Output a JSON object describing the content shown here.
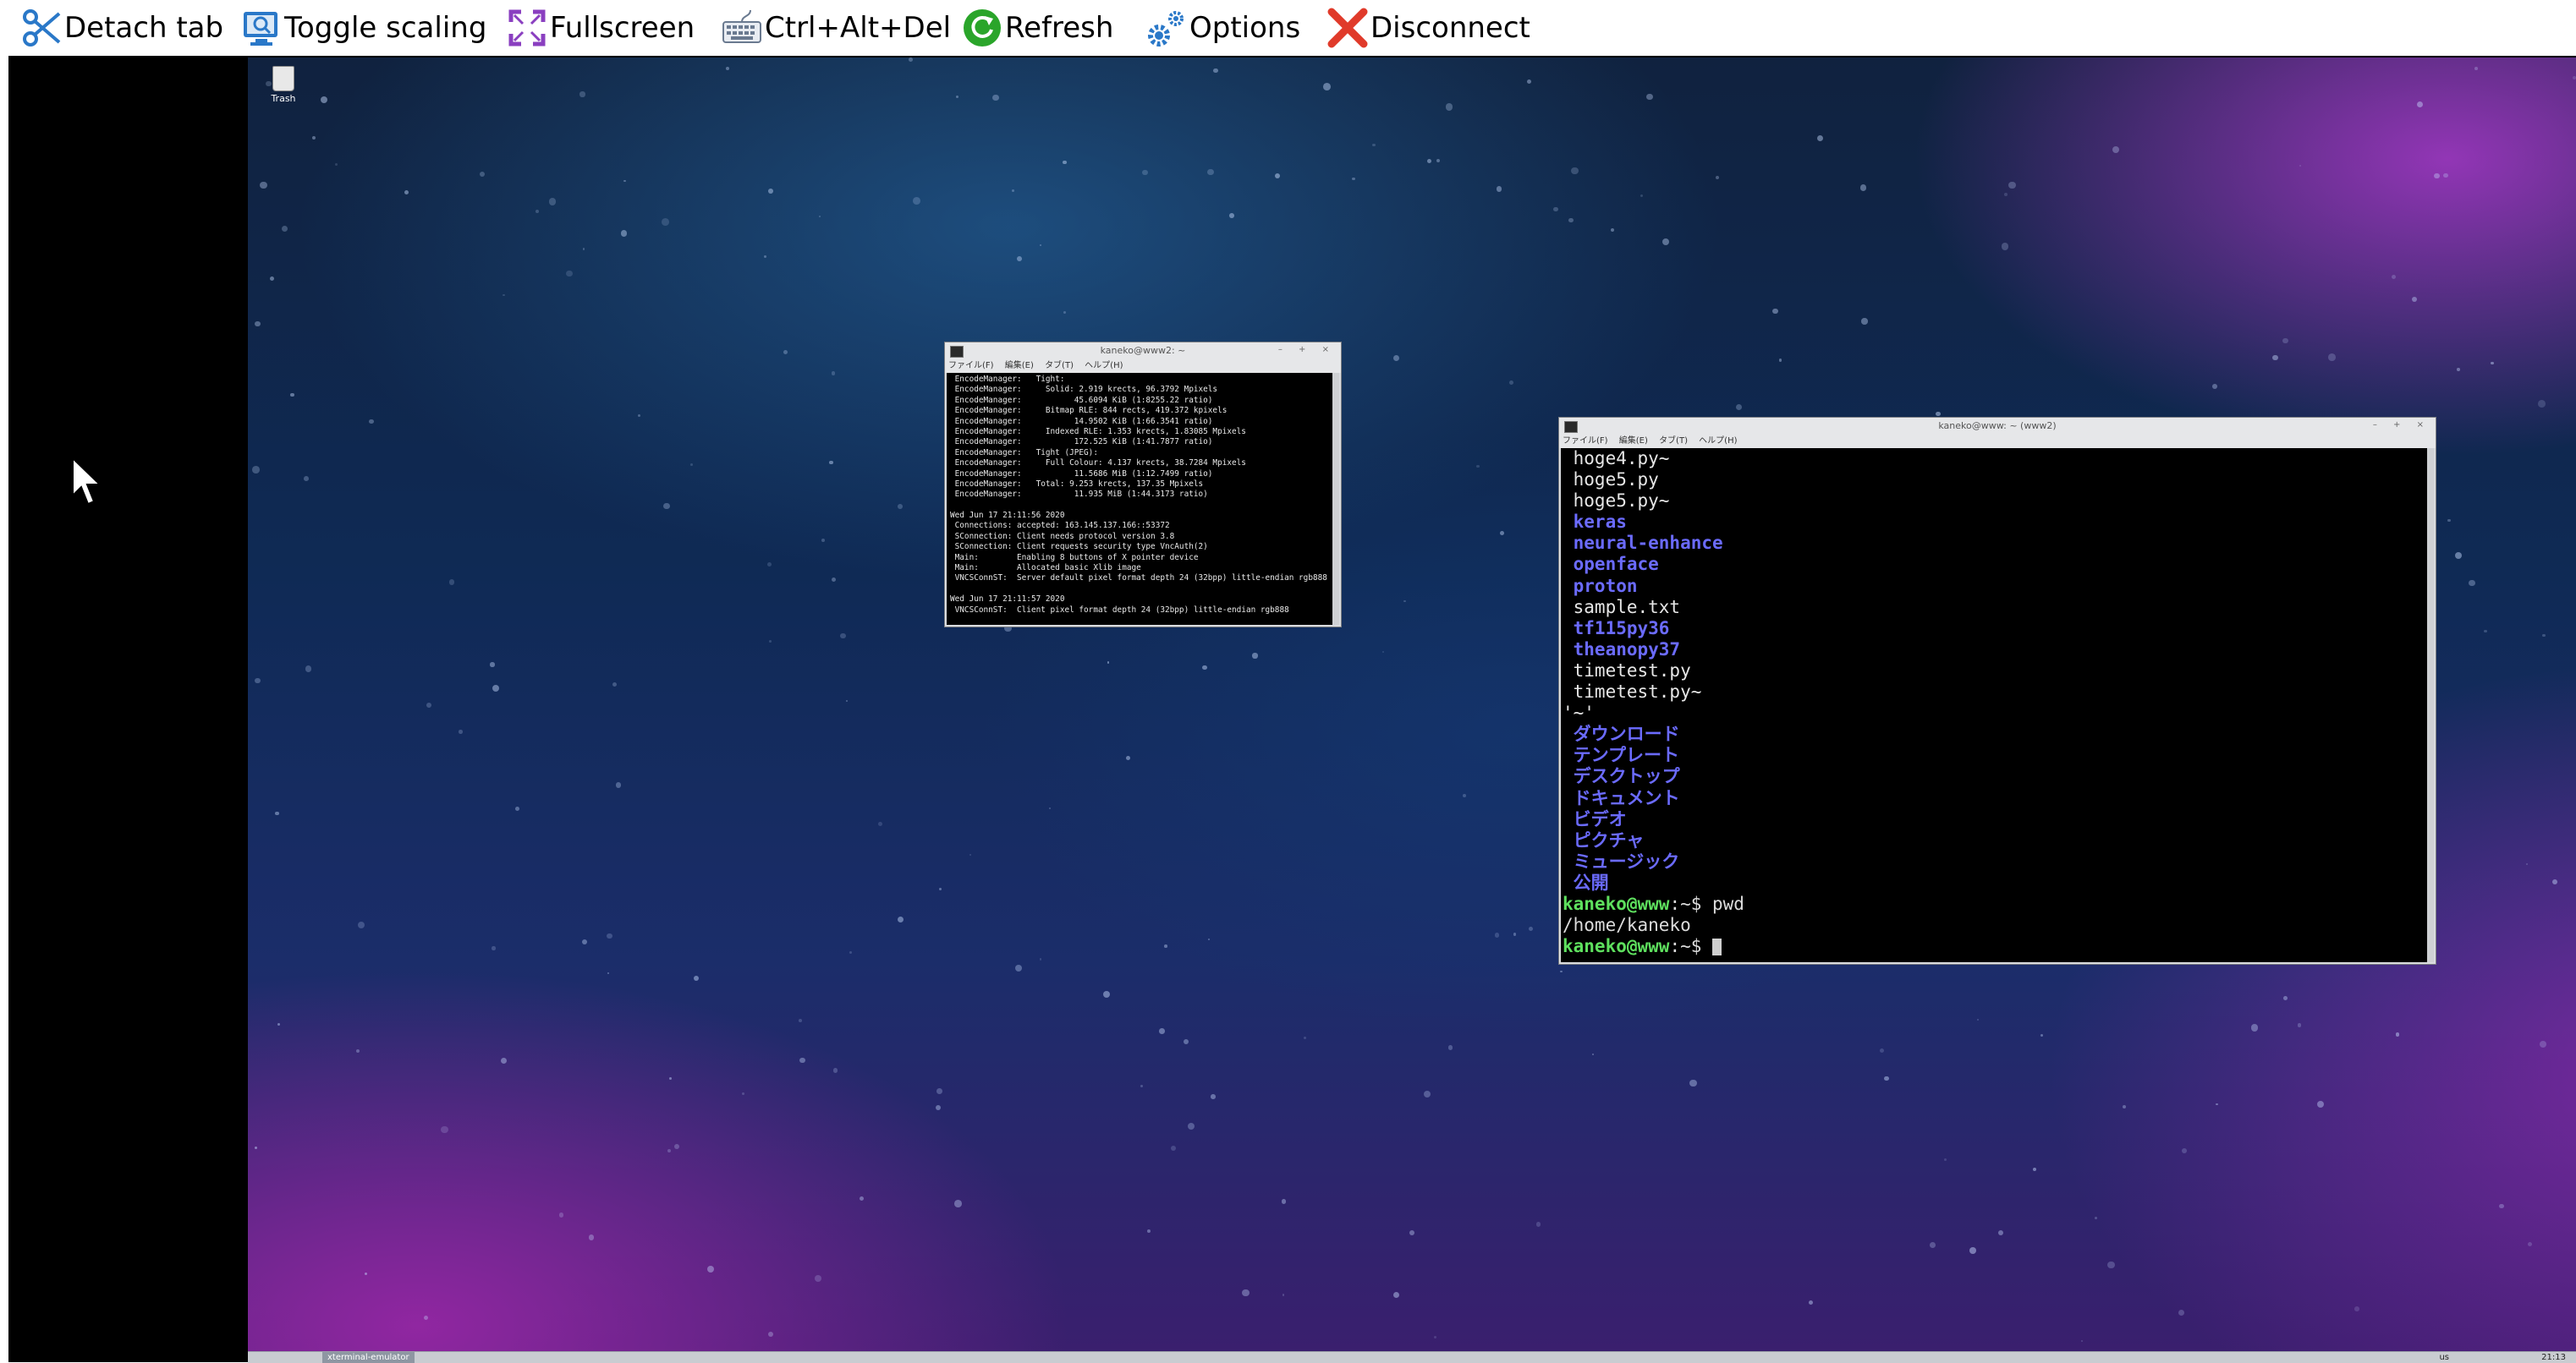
{
  "toolbar": {
    "detach": "Detach tab",
    "scaling": "Toggle scaling",
    "fullscreen": "Fullscreen",
    "cad": "Ctrl+Alt+Del",
    "refresh": "Refresh",
    "options": "Options",
    "disconnect": "Disconnect"
  },
  "desktop": {
    "trash_label": "Trash"
  },
  "taskbar": {
    "task_label": "xterminal-emulator",
    "lang": "us",
    "clock": "21:13"
  },
  "small_terminal": {
    "title": "kaneko@www2: ~",
    "menu": [
      "ファイル(F)",
      "編集(E)",
      "タブ(T)",
      "ヘルプ(H)"
    ],
    "lines": [
      " EncodeManager:   Tight:",
      " EncodeManager:     Solid: 2.919 krects, 96.3792 Mpixels",
      " EncodeManager:           45.6094 KiB (1:8255.22 ratio)",
      " EncodeManager:     Bitmap RLE: 844 rects, 419.372 kpixels",
      " EncodeManager:           14.9502 KiB (1:66.3541 ratio)",
      " EncodeManager:     Indexed RLE: 1.353 krects, 1.83085 Mpixels",
      " EncodeManager:           172.525 KiB (1:41.7877 ratio)",
      " EncodeManager:   Tight (JPEG):",
      " EncodeManager:     Full Colour: 4.137 krects, 38.7284 Mpixels",
      " EncodeManager:           11.5686 MiB (1:12.7499 ratio)",
      " EncodeManager:   Total: 9.253 krects, 137.35 Mpixels",
      " EncodeManager:           11.935 MiB (1:44.3173 ratio)",
      "",
      "Wed Jun 17 21:11:56 2020",
      " Connections: accepted: 163.145.137.166::53372",
      " SConnection: Client needs protocol version 3.8",
      " SConnection: Client requests security type VncAuth(2)",
      " Main:        Enabling 8 buttons of X pointer device",
      " Main:        Allocated basic Xlib image",
      " VNCSConnST:  Server default pixel format depth 24 (32bpp) little-endian rgb888",
      "",
      "Wed Jun 17 21:11:57 2020",
      " VNCSConnST:  Client pixel format depth 24 (32bpp) little-endian rgb888"
    ]
  },
  "large_terminal": {
    "title": "kaneko@www: ~ (www2)",
    "menu": [
      "ファイル(F)",
      "編集(E)",
      "タブ(T)",
      "ヘルプ(H)"
    ],
    "entries": [
      {
        "text": " hoge4.py~",
        "kind": "file"
      },
      {
        "text": " hoge5.py",
        "kind": "file"
      },
      {
        "text": " hoge5.py~",
        "kind": "file"
      },
      {
        "text": " keras",
        "kind": "dir"
      },
      {
        "text": " neural-enhance",
        "kind": "dir"
      },
      {
        "text": " openface",
        "kind": "dir"
      },
      {
        "text": " proton",
        "kind": "dir"
      },
      {
        "text": " sample.txt",
        "kind": "file"
      },
      {
        "text": " tf115py36",
        "kind": "dir"
      },
      {
        "text": " theanopy37",
        "kind": "dir"
      },
      {
        "text": " timetest.py",
        "kind": "file"
      },
      {
        "text": " timetest.py~",
        "kind": "file"
      },
      {
        "text": "'~'",
        "kind": "file"
      },
      {
        "text": " ダウンロード",
        "kind": "dir"
      },
      {
        "text": " テンプレート",
        "kind": "dir"
      },
      {
        "text": " デスクトップ",
        "kind": "dir"
      },
      {
        "text": " ドキュメント",
        "kind": "dir"
      },
      {
        "text": " ビデオ",
        "kind": "dir"
      },
      {
        "text": " ピクチャ",
        "kind": "dir"
      },
      {
        "text": " ミュージック",
        "kind": "dir"
      },
      {
        "text": " 公開",
        "kind": "dir"
      }
    ],
    "prompt1_user": "kaneko@www",
    "prompt1_rest": ":~$ pwd",
    "output": "/home/kaneko",
    "prompt2_user": "kaneko@www",
    "prompt2_rest": ":~$ "
  },
  "colors": {
    "dir": "#6b6bff",
    "prompt": "#5ee05e",
    "disconnect": "#e03a2a",
    "refresh": "#2aa52a",
    "icons": "#2a78c8"
  }
}
